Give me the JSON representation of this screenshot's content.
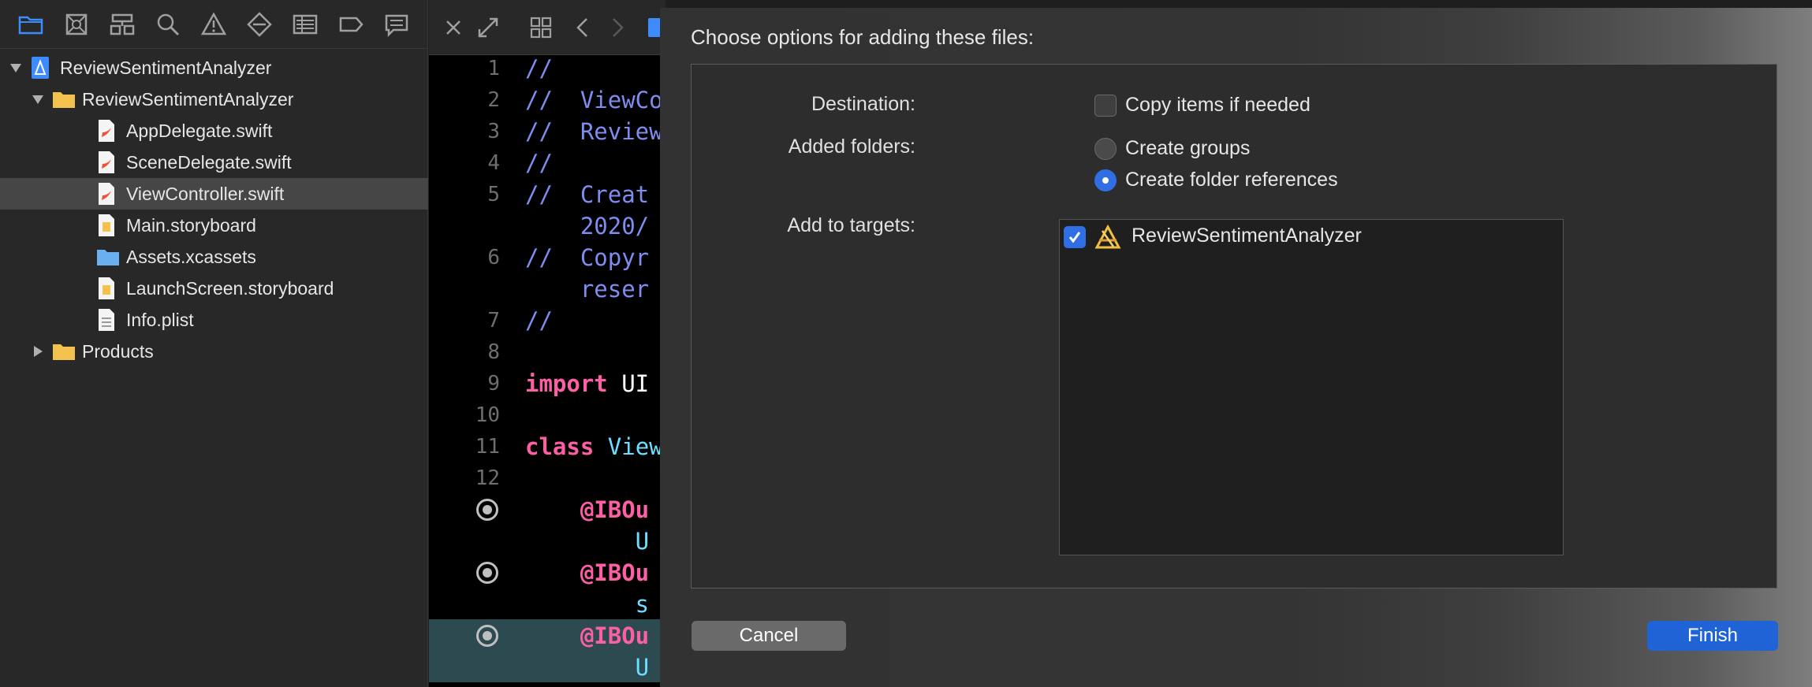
{
  "navigator": {
    "toolbar_icons": [
      "folder-icon",
      "source-control-icon",
      "symbol-icon",
      "search-icon",
      "warning-icon",
      "test-icon",
      "debug-icon",
      "breakpoint-icon",
      "report-icon"
    ],
    "tree": [
      {
        "label": "ReviewSentimentAnalyzer",
        "icon": "project-icon",
        "depth": 0,
        "disclosure": "open",
        "selected": false
      },
      {
        "label": "ReviewSentimentAnalyzer",
        "icon": "folder-icon",
        "depth": 1,
        "disclosure": "open",
        "selected": false
      },
      {
        "label": "AppDelegate.swift",
        "icon": "swift-file-icon",
        "depth": 2,
        "disclosure": "none",
        "selected": false
      },
      {
        "label": "SceneDelegate.swift",
        "icon": "swift-file-icon",
        "depth": 2,
        "disclosure": "none",
        "selected": false
      },
      {
        "label": "ViewController.swift",
        "icon": "swift-file-icon",
        "depth": 2,
        "disclosure": "none",
        "selected": true
      },
      {
        "label": "Main.storyboard",
        "icon": "storyboard-file-icon",
        "depth": 2,
        "disclosure": "none",
        "selected": false
      },
      {
        "label": "Assets.xcassets",
        "icon": "assets-folder-icon",
        "depth": 2,
        "disclosure": "none",
        "selected": false
      },
      {
        "label": "LaunchScreen.storyboard",
        "icon": "storyboard-file-icon",
        "depth": 2,
        "disclosure": "none",
        "selected": false
      },
      {
        "label": "Info.plist",
        "icon": "plist-file-icon",
        "depth": 2,
        "disclosure": "none",
        "selected": false
      },
      {
        "label": "Products",
        "icon": "folder-icon",
        "depth": 1,
        "disclosure": "closed",
        "selected": false
      }
    ]
  },
  "editor": {
    "toolbar_icons": [
      "close-icon",
      "expand-icon",
      "grid-icon",
      "back-icon",
      "forward-icon"
    ],
    "lines": [
      {
        "num": "1",
        "text": "//",
        "style": "comment"
      },
      {
        "num": "2",
        "text": "//  ViewCo",
        "style": "comment"
      },
      {
        "num": "3",
        "text": "//  Review",
        "style": "comment"
      },
      {
        "num": "4",
        "text": "//",
        "style": "comment"
      },
      {
        "num": "5",
        "text": "//  Creat",
        "style": "comment"
      },
      {
        "num": "",
        "text": "    2020/",
        "style": "comment"
      },
      {
        "num": "6",
        "text": "//  Copyr",
        "style": "comment"
      },
      {
        "num": "",
        "text": "    reser",
        "style": "comment"
      },
      {
        "num": "7",
        "text": "//",
        "style": "comment"
      },
      {
        "num": "8",
        "text": "",
        "style": "plain"
      },
      {
        "num": "9",
        "kw": "import",
        "rest": " UI",
        "style": "import"
      },
      {
        "num": "10",
        "text": "",
        "style": "plain"
      },
      {
        "num": "11",
        "kw": "class",
        "rest": " View",
        "style": "class"
      },
      {
        "num": "12",
        "text": "",
        "style": "plain"
      },
      {
        "num": "",
        "text": "    @IBOu",
        "style": "outlet",
        "breakpoint": true
      },
      {
        "num": "",
        "text": "        U",
        "style": "type"
      },
      {
        "num": "",
        "text": "    @IBOu",
        "style": "outlet",
        "breakpoint": true
      },
      {
        "num": "",
        "text": "        s",
        "style": "type"
      },
      {
        "num": "",
        "text": "    @IBOu",
        "style": "outlet",
        "breakpoint": true,
        "highlight": true
      },
      {
        "num": "",
        "text": "        U",
        "style": "type",
        "highlight": true
      }
    ]
  },
  "dialog": {
    "title": "Choose options for adding these files:",
    "destination_label": "Destination:",
    "copy_items_label": "Copy items if needed",
    "copy_items_checked": false,
    "added_folders_label": "Added folders:",
    "create_groups_label": "Create groups",
    "create_folder_refs_label": "Create folder references",
    "selected_folder_option": "Create folder references",
    "add_to_targets_label": "Add to targets:",
    "target_name": "ReviewSentimentAnalyzer",
    "target_checked": true,
    "target_icon": "app-target-icon",
    "cancel_label": "Cancel",
    "finish_label": "Finish",
    "accent_color": "#1f63d6"
  }
}
